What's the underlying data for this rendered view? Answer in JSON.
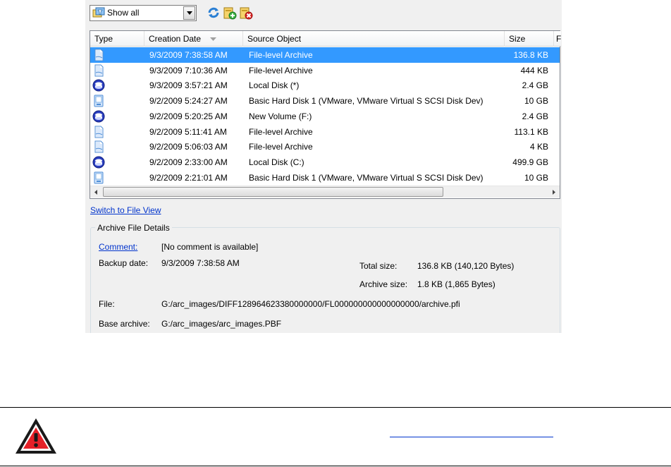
{
  "toolbar": {
    "filter_value": "Show all",
    "icons": [
      "filter-icon",
      "refresh-icon",
      "add-archive-icon",
      "delete-archive-icon"
    ]
  },
  "columns": {
    "type": "Type",
    "creation_date": "Creation Date",
    "source_object": "Source Object",
    "size": "Size",
    "extra": "F"
  },
  "rows": [
    {
      "icon": "file-archive-icon",
      "date": "9/3/2009 7:38:58 AM",
      "source": "File-level Archive",
      "size": "136.8 KB",
      "selected": true
    },
    {
      "icon": "file-archive-icon",
      "date": "9/3/2009 7:10:36 AM",
      "source": "File-level Archive",
      "size": "444 KB",
      "selected": false
    },
    {
      "icon": "volume-icon",
      "date": "9/3/2009 3:57:21 AM",
      "source": "Local Disk (*)",
      "size": "2.4 GB",
      "selected": false
    },
    {
      "icon": "hard-disk-icon",
      "date": "9/2/2009 5:24:27 AM",
      "source": "Basic Hard Disk 1 (VMware, VMware Virtual S SCSI Disk Dev)",
      "size": "10 GB",
      "selected": false
    },
    {
      "icon": "volume-icon",
      "date": "9/2/2009 5:20:25 AM",
      "source": "New Volume (F:)",
      "size": "2.4 GB",
      "selected": false
    },
    {
      "icon": "file-archive-icon",
      "date": "9/2/2009 5:11:41 AM",
      "source": "File-level Archive",
      "size": "113.1 KB",
      "selected": false
    },
    {
      "icon": "file-archive-icon",
      "date": "9/2/2009 5:06:03 AM",
      "source": "File-level Archive",
      "size": "4 KB",
      "selected": false
    },
    {
      "icon": "volume-icon",
      "date": "9/2/2009 2:33:00 AM",
      "source": "Local Disk (C:)",
      "size": "499.9 GB",
      "selected": false
    },
    {
      "icon": "hard-disk-icon",
      "date": "9/2/2009 2:21:01 AM",
      "source": "Basic Hard Disk 1 (VMware, VMware Virtual S SCSI Disk Dev)",
      "size": "10 GB",
      "selected": false
    }
  ],
  "switch_view_link": "Switch to File View",
  "details": {
    "title": "Archive File Details",
    "comment_label": "Comment:",
    "comment_value": "[No comment is available]",
    "backup_date_label": "Backup date:",
    "backup_date_value": "9/3/2009 7:38:58 AM",
    "total_size_label": "Total size:",
    "total_size_value": "136.8 KB (140,120 Bytes)",
    "archive_size_label": "Archive size:",
    "archive_size_value": "1.8 KB (1,865 Bytes)",
    "file_label": "File:",
    "file_value": "G:/arc_images/DIFF128964623380000000/FL000000000000000000/archive.pfi",
    "base_archive_label": "Base archive:",
    "base_archive_value": "G:/arc_images/arc_images.PBF"
  },
  "colors": {
    "selection": "#3399ff",
    "link": "#0033cc",
    "warning_red": "#e52128"
  }
}
